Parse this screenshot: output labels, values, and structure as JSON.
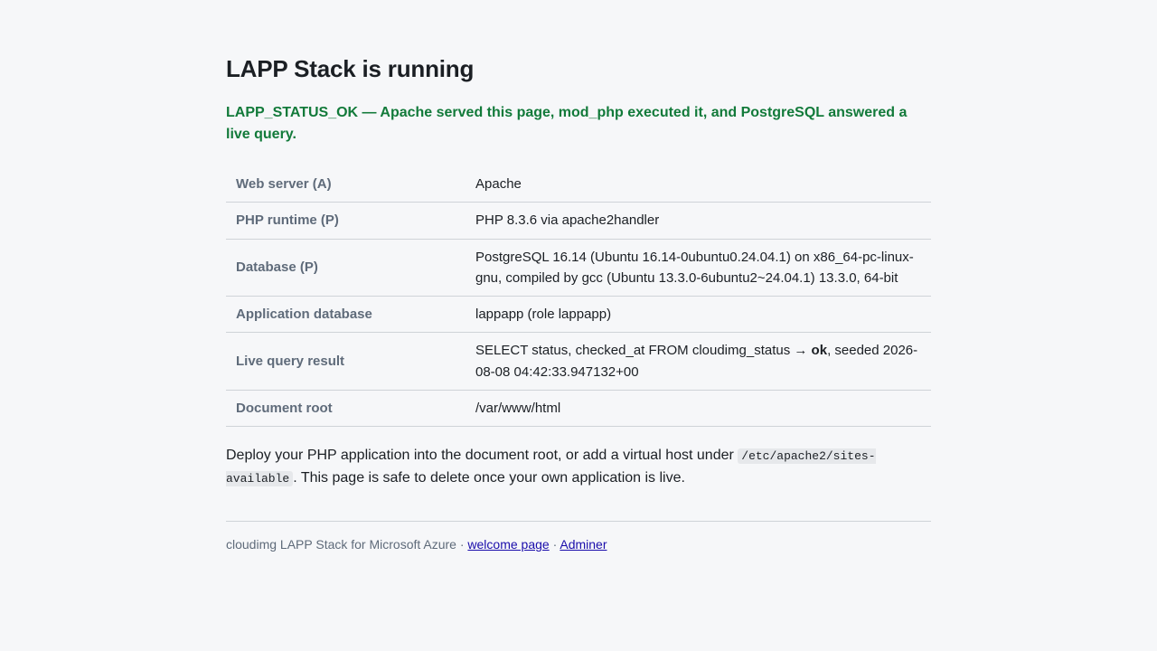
{
  "header": {
    "title": "LAPP Stack is running",
    "status_message": "LAPP_STATUS_OK — Apache served this page, mod_php executed it, and PostgreSQL answered a live query."
  },
  "info_table": {
    "rows": [
      {
        "label": "Web server (A)",
        "value": "Apache"
      },
      {
        "label": "PHP runtime (P)",
        "value": "PHP 8.3.6 via apache2handler"
      },
      {
        "label": "Database (P)",
        "value": "PostgreSQL 16.14 (Ubuntu 16.14-0ubuntu0.24.04.1) on x86_64-pc-linux-gnu, compiled by gcc (Ubuntu 13.3.0-6ubuntu2~24.04.1) 13.3.0, 64-bit"
      },
      {
        "label": "Application database",
        "value": "lappapp (role lappapp)"
      },
      {
        "label": "Live query result",
        "value_prefix": "SELECT status, checked_at FROM cloudimg_status → ",
        "value_bold": "ok",
        "value_suffix": ", seeded 2026-08-08 04:42:33.947132+00"
      },
      {
        "label": "Document root",
        "value": "/var/www/html"
      }
    ]
  },
  "note": {
    "text_before": "Deploy your PHP application into the document root, or add a virtual host under ",
    "code": "/etc/apache2/sites-available",
    "text_after": ". This page is safe to delete once your own application is live."
  },
  "footer": {
    "text": "cloudimg LAPP Stack for Microsoft Azure · ",
    "separator": " · ",
    "welcome_link": "welcome page",
    "adminer_link": "Adminer"
  },
  "colors": {
    "status_green": "#127a3a",
    "label_gray": "#5f6b7a",
    "link_blue": "#1a0dab",
    "background": "#f6f7f9"
  }
}
